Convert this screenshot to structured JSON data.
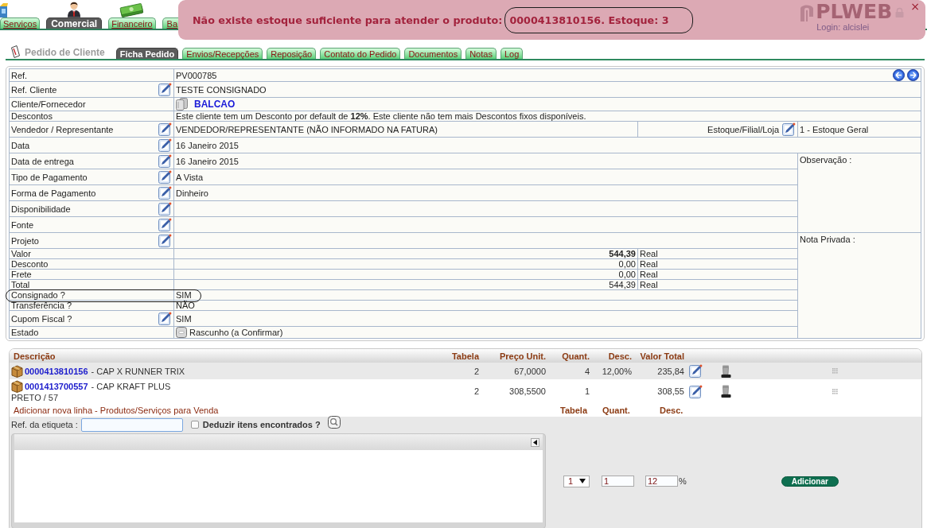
{
  "top_nav": {
    "tabs": [
      {
        "label": "Serviços",
        "selected": false
      },
      {
        "label": "Comercial",
        "selected": true
      },
      {
        "label": "Financeiro",
        "selected": false
      },
      {
        "label": "Ba",
        "selected": false
      }
    ]
  },
  "alert": {
    "message": "Não existe estoque suficiente para atender o produto:",
    "circled_text": "0000413810156. Estoque: 3",
    "close": "×"
  },
  "brand": {
    "logo": "PLWEB",
    "login": "Login: alcislei"
  },
  "page": {
    "title": "Pedido de Cliente",
    "tabs": [
      {
        "label": "Ficha Pedido",
        "selected": true
      },
      {
        "label": "Envios/Recepções",
        "selected": false
      },
      {
        "label": "Reposição",
        "selected": false
      },
      {
        "label": "Contato do Pedido",
        "selected": false
      },
      {
        "label": "Documentos",
        "selected": false
      },
      {
        "label": "Notas",
        "selected": false
      },
      {
        "label": "Log",
        "selected": false
      }
    ]
  },
  "order": {
    "header_rows": [
      {
        "kind": "nav",
        "label": "Ref.",
        "editable": false,
        "circled": false,
        "value": "PV000785"
      },
      {
        "kind": "text",
        "label": "Ref. Cliente",
        "editable": true,
        "circled": false,
        "value": "TESTE CONSIGNADO"
      },
      {
        "kind": "link",
        "label": "Cliente/Fornecedor",
        "editable": false,
        "circled": false,
        "value": "BALCAO"
      },
      {
        "kind": "text",
        "label": "Descontos",
        "editable": false,
        "circled": false,
        "value": "Este cliente tem um Desconto por default de **12%**. Este cliente não tem mais Descontos fixos disponíveis."
      },
      {
        "kind": "split",
        "label": "Vendedor / Representante",
        "editable": true,
        "circled": false,
        "value": "VENDEDOR/REPRESENTANTE (NÃO INFORMADO NA FATURA)",
        "side_label": "Estoque/Filial/Loja",
        "side_editable": true,
        "side_value": "1 - Estoque Geral"
      },
      {
        "kind": "text",
        "label": "Data",
        "editable": true,
        "circled": false,
        "value": "16 Janeiro 2015"
      }
    ],
    "sections": [
      {
        "note": "Observação :",
        "rows": [
          {
            "kind": "text",
            "label": "Data de entrega",
            "editable": true,
            "circled": false,
            "value": "16 Janeiro 2015"
          },
          {
            "kind": "text",
            "label": "Tipo de Pagamento",
            "editable": true,
            "circled": false,
            "value": "A Vista"
          },
          {
            "kind": "text",
            "label": "Forma de Pagamento",
            "editable": true,
            "circled": false,
            "value": "Dinheiro"
          },
          {
            "kind": "text",
            "label": "Disponibilidade",
            "editable": true,
            "circled": false
          },
          {
            "kind": "text",
            "label": "Fonte",
            "editable": true,
            "circled": false
          }
        ]
      },
      {
        "note": "Nota Privada :",
        "rows": [
          {
            "kind": "text",
            "label": "Projeto",
            "editable": true,
            "circled": false
          },
          {
            "kind": "amount",
            "label": "Valor",
            "editable": false,
            "circled": false,
            "value": "544,39",
            "currency": "Real",
            "bold": true
          },
          {
            "kind": "amount",
            "label": "Desconto",
            "editable": false,
            "circled": false,
            "value": "0,00",
            "currency": "Real",
            "bold": false
          },
          {
            "kind": "amount",
            "label": "Frete",
            "editable": false,
            "circled": false,
            "value": "0,00",
            "currency": "Real",
            "bold": false
          },
          {
            "kind": "amount",
            "label": "Total",
            "editable": false,
            "circled": false,
            "value": "544,39",
            "currency": "Real",
            "bold": false
          },
          {
            "kind": "text",
            "label": "Consignado ?",
            "editable": false,
            "circled": true,
            "value": "SIM"
          },
          {
            "kind": "text",
            "label": "Transferência ?",
            "editable": false,
            "circled": false,
            "value": "NÃO"
          },
          {
            "kind": "text",
            "label": "Cupom Fiscal ?",
            "editable": true,
            "circled": false,
            "value": "SIM"
          },
          {
            "kind": "status",
            "label": "Estado",
            "editable": false,
            "circled": false,
            "value": "Rascunho (a Confirmar)"
          }
        ]
      }
    ]
  },
  "items": {
    "columns": [
      "Descrição",
      "Tabela",
      "Preço Unit.",
      "Quant.",
      "Desc.",
      "Valor Total"
    ],
    "rows": [
      {
        "code": "0000413810156",
        "name": "- CAP X RUNNER TRIX",
        "table": "2",
        "unit_price": "67,0000",
        "quantity": "4",
        "discount": "12,00%",
        "total": "235,84"
      },
      {
        "code": "0001413700557",
        "name": "- CAP KRAFT PLUS",
        "variant": "PRETO / 57",
        "table": "2",
        "unit_price": "308,5500",
        "quantity": "1",
        "total": "308,55"
      }
    ]
  },
  "add_line": {
    "title": "Adicionar nova linha - Produtos/Serviços para Venda",
    "columns": [
      "Tabela",
      "Quant.",
      "Desc."
    ],
    "tag_label": "Ref. da etiqueta :",
    "deduct": {
      "label": "Deduzir itens encontrados ?",
      "checked": false
    },
    "table_select": "1",
    "quantity": "1",
    "discount": "12",
    "unit": "%",
    "button": "Adicionar"
  }
}
